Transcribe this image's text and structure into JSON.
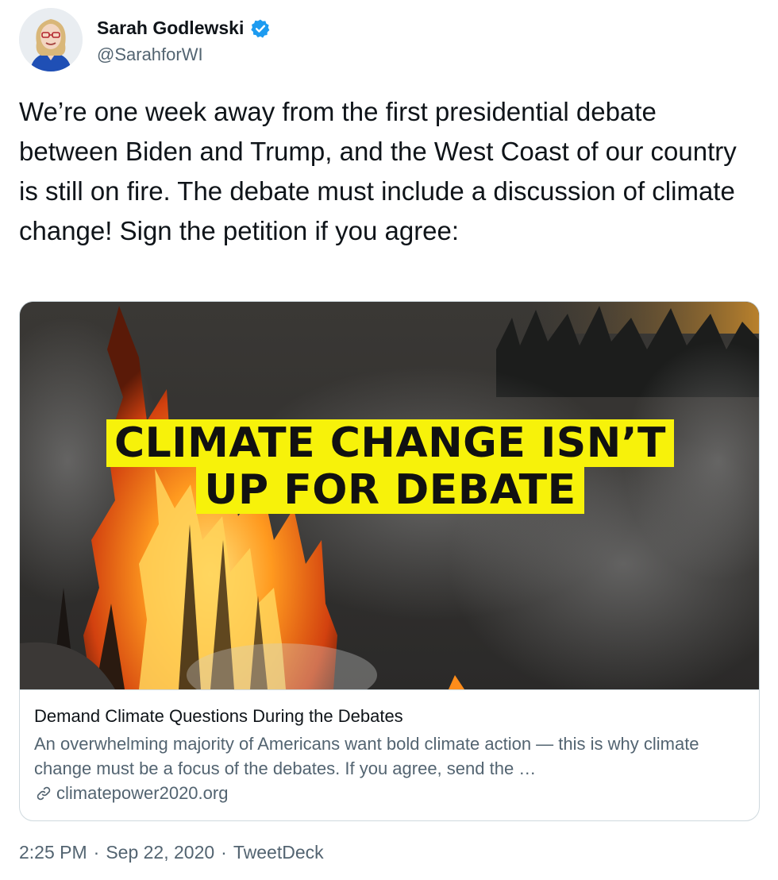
{
  "author": {
    "name": "Sarah Godlewski",
    "handle": "@SarahforWI",
    "verified_icon": "verified-badge-icon",
    "avatar_icon": "avatar",
    "brand_color": "#1d9bf0"
  },
  "tweet": {
    "text": "We’re one week away from the first presidential debate between Biden and Trump, and the West Coast of our country is still on fire. The debate must include a discussion of climate change! Sign the petition if you agree:"
  },
  "card": {
    "image_headline_line1": "CLIMATE CHANGE ISN’T",
    "image_headline_line2": "UP FOR DEBATE",
    "headline_bg_color": "#f7f20a",
    "title": "Demand Climate Questions During the Debates",
    "description": "An overwhelming majority of Americans want bold climate action — this is why climate change must be a focus of the debates. If you agree, send the …",
    "domain": "climatepower2020.org",
    "link_icon": "link-icon"
  },
  "meta": {
    "time": "2:25 PM",
    "date": "Sep 22, 2020",
    "source": "TweetDeck",
    "separator": "·"
  }
}
